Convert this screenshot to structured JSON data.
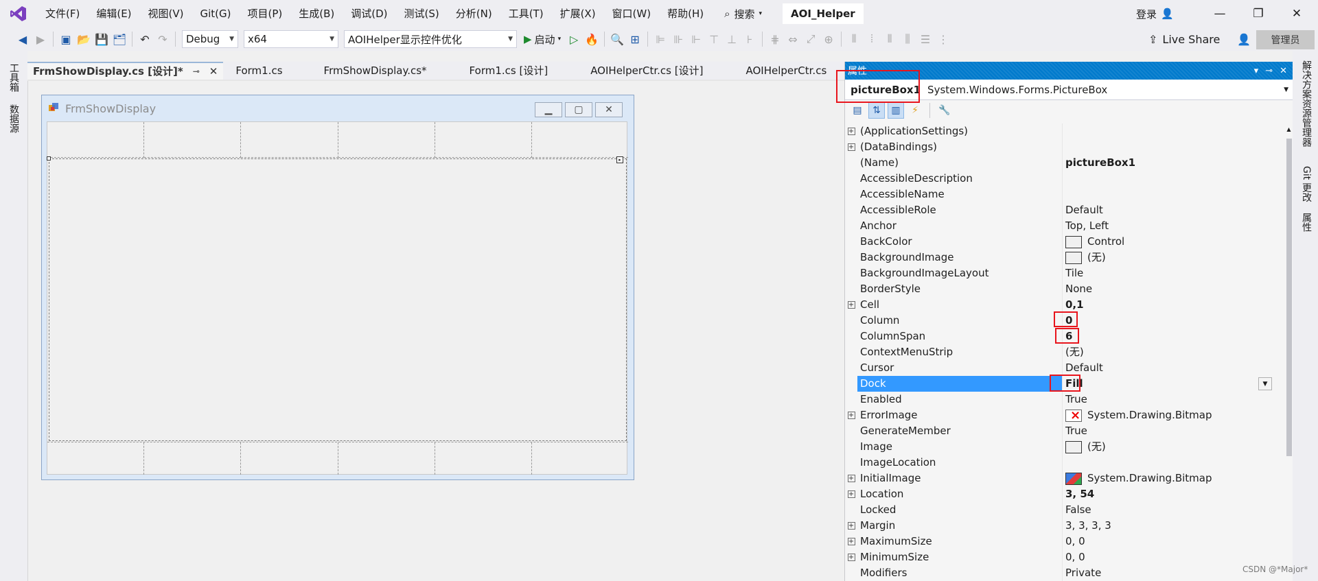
{
  "menubar": {
    "items": [
      "文件(F)",
      "编辑(E)",
      "视图(V)",
      "Git(G)",
      "项目(P)",
      "生成(B)",
      "调试(D)",
      "测试(S)",
      "分析(N)",
      "工具(T)",
      "扩展(X)",
      "窗口(W)",
      "帮助(H)"
    ],
    "search_label": "搜索",
    "solution_name": "AOI_Helper",
    "login_label": "登录"
  },
  "toolbar": {
    "config": "Debug",
    "platform": "x64",
    "project": "AOIHelper显示控件优化",
    "start_label": "启动",
    "liveshare_label": "Live Share",
    "admin_label": "管理员"
  },
  "left_bar": {
    "toolbox": "工具箱",
    "datasource": "数据源"
  },
  "right_bar": {
    "solution_explorer": "解决方案资源管理器",
    "git_changes": "Git 更改",
    "properties": "属性"
  },
  "doc_tabs": [
    "FrmShowDisplay.cs [设计]*",
    "Form1.cs",
    "FrmShowDisplay.cs*",
    "Form1.cs [设计]",
    "AOIHelperCtr.cs [设计]",
    "AOIHelperCtr.cs"
  ],
  "form": {
    "title": "FrmShowDisplay"
  },
  "properties_panel": {
    "title": "属性",
    "object_name": "pictureBox1",
    "object_type": "System.Windows.Forms.PictureBox",
    "rows": [
      {
        "name": "(ApplicationSettings)",
        "value": "",
        "expand": true
      },
      {
        "name": "(DataBindings)",
        "value": "",
        "expand": true
      },
      {
        "name": "(Name)",
        "value": "pictureBox1",
        "bold": true
      },
      {
        "name": "AccessibleDescription",
        "value": ""
      },
      {
        "name": "AccessibleName",
        "value": ""
      },
      {
        "name": "AccessibleRole",
        "value": "Default"
      },
      {
        "name": "Anchor",
        "value": "Top, Left"
      },
      {
        "name": "BackColor",
        "value": "Control",
        "swatch": "plain"
      },
      {
        "name": "BackgroundImage",
        "value": "(无)",
        "swatch": "plain"
      },
      {
        "name": "BackgroundImageLayout",
        "value": "Tile"
      },
      {
        "name": "BorderStyle",
        "value": "None"
      },
      {
        "name": "Cell",
        "value": "0,1",
        "bold": true,
        "expand": true
      },
      {
        "name": "Column",
        "value": "0",
        "bold": true
      },
      {
        "name": "ColumnSpan",
        "value": "6",
        "bold": true
      },
      {
        "name": "ContextMenuStrip",
        "value": "(无)"
      },
      {
        "name": "Cursor",
        "value": "Default"
      },
      {
        "name": "Dock",
        "value": "Fill",
        "bold": true,
        "selected": true
      },
      {
        "name": "Enabled",
        "value": "True"
      },
      {
        "name": "ErrorImage",
        "value": "System.Drawing.Bitmap",
        "swatch": "err",
        "expand": true
      },
      {
        "name": "GenerateMember",
        "value": "True"
      },
      {
        "name": "Image",
        "value": "(无)",
        "swatch": "plain"
      },
      {
        "name": "ImageLocation",
        "value": ""
      },
      {
        "name": "InitialImage",
        "value": "System.Drawing.Bitmap",
        "swatch": "img",
        "expand": true
      },
      {
        "name": "Location",
        "value": "3, 54",
        "bold": true,
        "expand": true
      },
      {
        "name": "Locked",
        "value": "False"
      },
      {
        "name": "Margin",
        "value": "3, 3, 3, 3",
        "expand": true
      },
      {
        "name": "MaximumSize",
        "value": "0, 0",
        "expand": true
      },
      {
        "name": "MinimumSize",
        "value": "0, 0",
        "expand": true
      },
      {
        "name": "Modifiers",
        "value": "Private"
      }
    ]
  },
  "watermark": "CSDN @*Major*"
}
